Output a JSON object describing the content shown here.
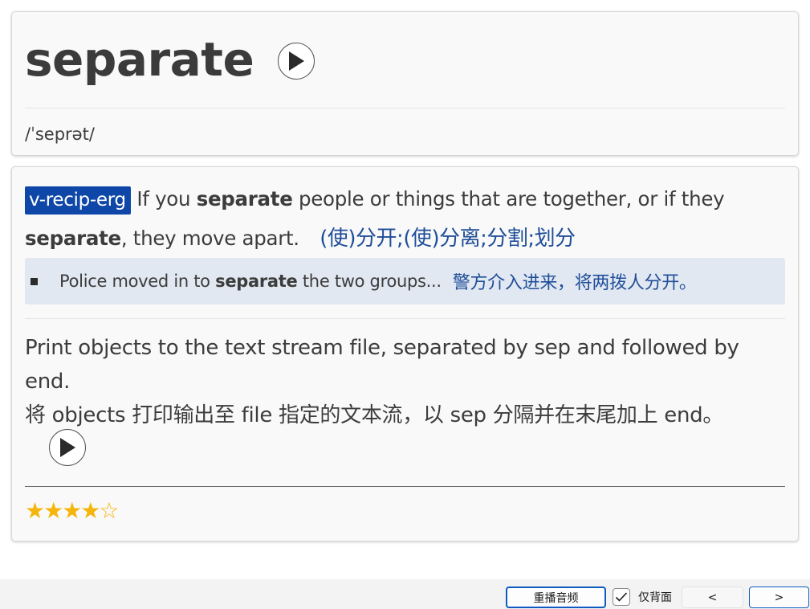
{
  "word": {
    "headword": "separate",
    "phonetic": "/ˈseprət/"
  },
  "definition": {
    "pos_tag": "v-recip-erg",
    "text_1": "If you",
    "bold_1": "separate",
    "text_2": "people or things that are together, or if they",
    "bold_2": "separate",
    "text_3": ", they move apart.",
    "chinese": "(使)分开;(使)分离;分割;划分"
  },
  "example": {
    "text_1": "Police moved in to",
    "bold": "separate",
    "text_2": "the two groups...",
    "chinese": "警方介入进来，将两拨人分开。"
  },
  "note": {
    "english": "Print objects to the text stream file, separated by sep and followed by end.",
    "chinese": "将 objects 打印输出至 file 指定的文本流，以 sep 分隔并在末尾加上 end。"
  },
  "rating": {
    "filled": 4,
    "total": 5,
    "stars_filled": "★★★★",
    "stars_empty": "☆"
  },
  "toolbar": {
    "replay_label": "重播音频",
    "back_only_label": "仅背面",
    "back_only_checked": true,
    "prev_label": "<",
    "next_label": ">"
  },
  "colors": {
    "accent": "#0e47a8",
    "chinese_text": "#1f4e99",
    "example_bg": "#e2e8f1",
    "star": "#f5b50c"
  }
}
